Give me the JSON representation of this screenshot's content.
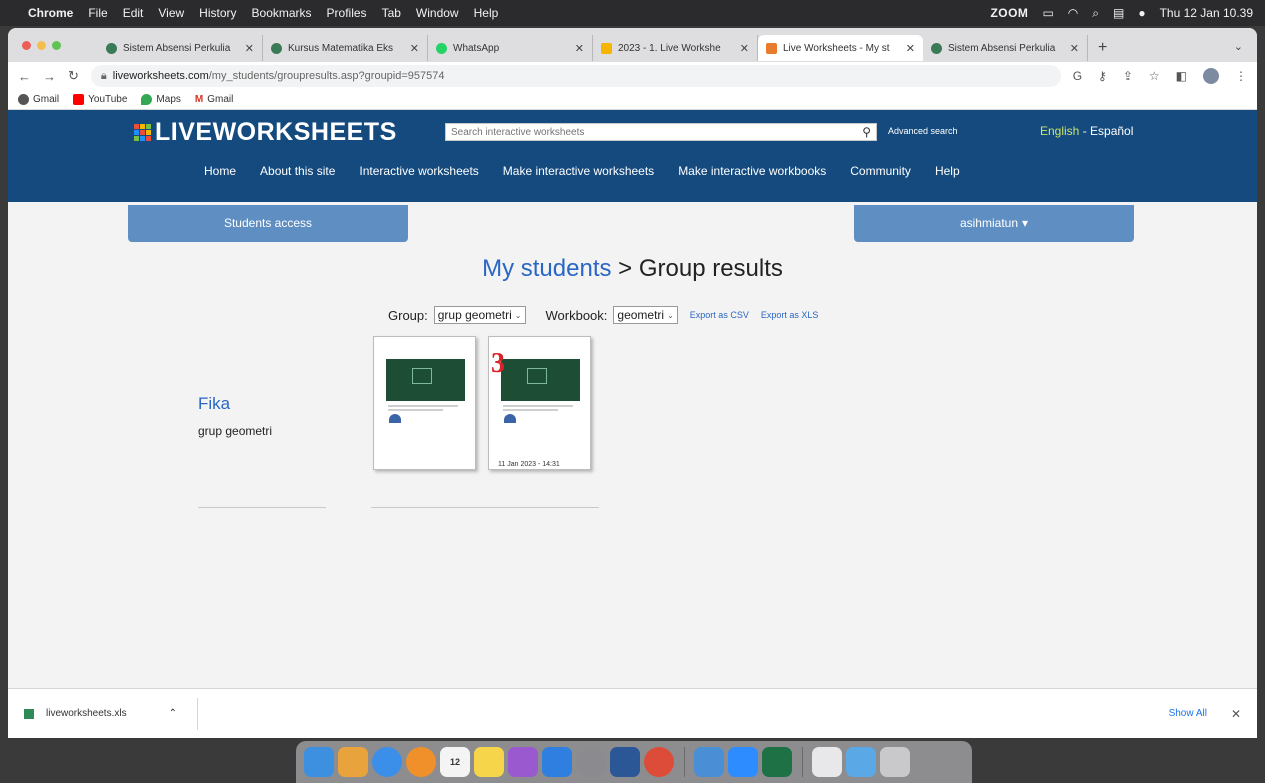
{
  "menubar": {
    "apple": "",
    "app": "Chrome",
    "items": [
      "File",
      "Edit",
      "View",
      "History",
      "Bookmarks",
      "Profiles",
      "Tab",
      "Window",
      "Help"
    ],
    "zoom": "ZOOM",
    "datetime": "Thu 12 Jan 10.39"
  },
  "tabs": [
    {
      "label": "Sistem Absensi Perkulia",
      "color": "#3b7a57"
    },
    {
      "label": "Kursus Matematika Eks",
      "color": "#3b7a57"
    },
    {
      "label": "WhatsApp",
      "color": "#25d366"
    },
    {
      "label": "2023 - 1. Live Workshe",
      "color": "#f4b400"
    },
    {
      "label": "Live Worksheets - My st",
      "color": "#e87c2c",
      "active": true
    },
    {
      "label": "Sistem Absensi Perkulia",
      "color": "#3b7a57"
    }
  ],
  "address": {
    "host": "liveworksheets.com",
    "path": "/my_students/groupresults.asp?groupid=957574"
  },
  "bookmarks": [
    {
      "label": "Gmail",
      "color": "#555555"
    },
    {
      "label": "YouTube",
      "color": "#ff0000"
    },
    {
      "label": "Maps",
      "color": "#34a853"
    },
    {
      "label": "Gmail",
      "color": "#d93025"
    }
  ],
  "site": {
    "logo": "LIVEWORKSHEETS",
    "search_placeholder": "Search interactive worksheets",
    "advanced_search": "Advanced search",
    "lang_en": "English",
    "lang_es": " - Español",
    "nav": [
      "Home",
      "About this site",
      "Interactive worksheets",
      "Make interactive worksheets",
      "Make interactive workbooks",
      "Community",
      "Help"
    ],
    "students_access": "Students access",
    "user": "asihmiatun",
    "user_caret": "▾"
  },
  "page": {
    "title_link": "My students",
    "title_rest": " > Group results",
    "group_label": "Group:",
    "group_value": "grup geometri",
    "workbook_label": "Workbook:",
    "workbook_value": "geometri",
    "export_csv": "Export as CSV",
    "export_xls": "Export as XLS"
  },
  "student": {
    "name": "Fika",
    "group": "grup geometri",
    "results": [
      {
        "score": "",
        "date": ""
      },
      {
        "score": "3",
        "date": "11 Jan 2023 - 14:31"
      }
    ]
  },
  "downloads": {
    "file": "liveworksheets.xls",
    "show_all": "Show All"
  },
  "dock_apps": [
    {
      "name": "finder",
      "color": "#3d8fe0",
      "label": ""
    },
    {
      "name": "launchpad",
      "color": "#e8a33d",
      "label": ""
    },
    {
      "name": "safari",
      "color": "#3b8fe8",
      "label": ""
    },
    {
      "name": "photos",
      "color": "#f0902a",
      "label": ""
    },
    {
      "name": "calendar",
      "color": "#f4f4f4",
      "label": "12"
    },
    {
      "name": "notes",
      "color": "#f6d54a",
      "label": ""
    },
    {
      "name": "podcasts",
      "color": "#9b59d0",
      "label": ""
    },
    {
      "name": "app-store",
      "color": "#2f7fe0",
      "label": ""
    },
    {
      "name": "settings",
      "color": "#8a8a8f",
      "label": ""
    },
    {
      "name": "word",
      "color": "#2b5797",
      "label": ""
    },
    {
      "name": "chrome",
      "color": "#dd4b39",
      "label": ""
    },
    {
      "name": "preview",
      "color": "#4a8fd6",
      "label": ""
    },
    {
      "name": "zoom",
      "color": "#2d8cff",
      "label": ""
    },
    {
      "name": "excel",
      "color": "#1e7145",
      "label": ""
    },
    {
      "name": "document",
      "color": "#e8e8ea",
      "label": ""
    },
    {
      "name": "downloads-folder",
      "color": "#5aa9e6",
      "label": ""
    },
    {
      "name": "trash",
      "color": "#c9c9cc",
      "label": ""
    }
  ]
}
